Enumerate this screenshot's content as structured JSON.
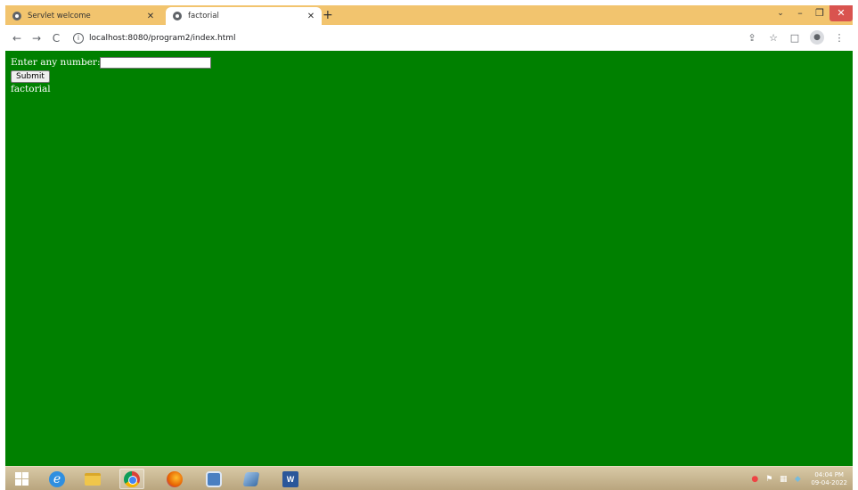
{
  "browser": {
    "tabs": [
      {
        "title": "Servlet welcome",
        "active": false
      },
      {
        "title": "factorial",
        "active": true
      }
    ],
    "new_tab": "+",
    "url": "localhost:8080/program2/index.html",
    "icons": {
      "back": "←",
      "forward": "→",
      "reload": "C",
      "info": "i",
      "share": "⇪",
      "star": "☆",
      "sidepanel": "□",
      "profile": "●",
      "menu": "⋮",
      "close": "✕",
      "minimize": "–",
      "maximize": "❐",
      "chevron": "⌄"
    }
  },
  "page": {
    "background": "#008000",
    "label": "Enter any number:",
    "input_value": "",
    "submit_label": "Submit",
    "result_text": "factorial"
  },
  "taskbar": {
    "word_label": "W",
    "ie_label": "e",
    "tray": {
      "time": "04:04 PM",
      "date": "09-04-2022"
    }
  }
}
